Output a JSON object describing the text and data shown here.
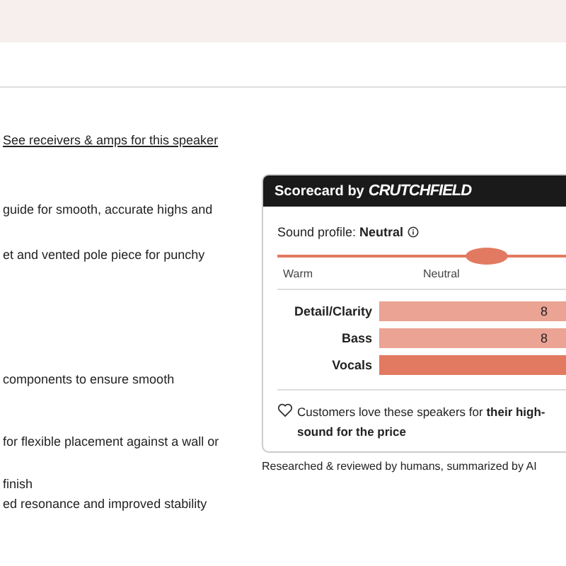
{
  "link": "See receivers & amps for this speaker",
  "feature_lines": [
    "guide for smooth, accurate highs and",
    "et and vented pole piece for punchy",
    "components to ensure smooth",
    "for flexible placement against a wall or",
    "finish",
    "ed resonance and improved stability"
  ],
  "scorecard": {
    "title": "Scorecard by",
    "brand": "CRUTCHFIELD",
    "sound_profile": {
      "label": "Sound profile: **Neutral**",
      "level": 0.65,
      "scale_labels": [
        "Warm",
        "Neutral"
      ]
    },
    "ratings": [
      {
        "label": "Detail/Clarity",
        "value": "8",
        "color": "#eba393"
      },
      {
        "label": "Bass",
        "value": "8",
        "color": "#eba393"
      },
      {
        "label": "Vocals",
        "color": "#e27a62"
      }
    ],
    "highlight": [
      "Customers love these speakers for **their high-**",
      "**sound for the price**"
    ]
  },
  "footnote": "Researched & reviewed by humans, summarized by AI"
}
